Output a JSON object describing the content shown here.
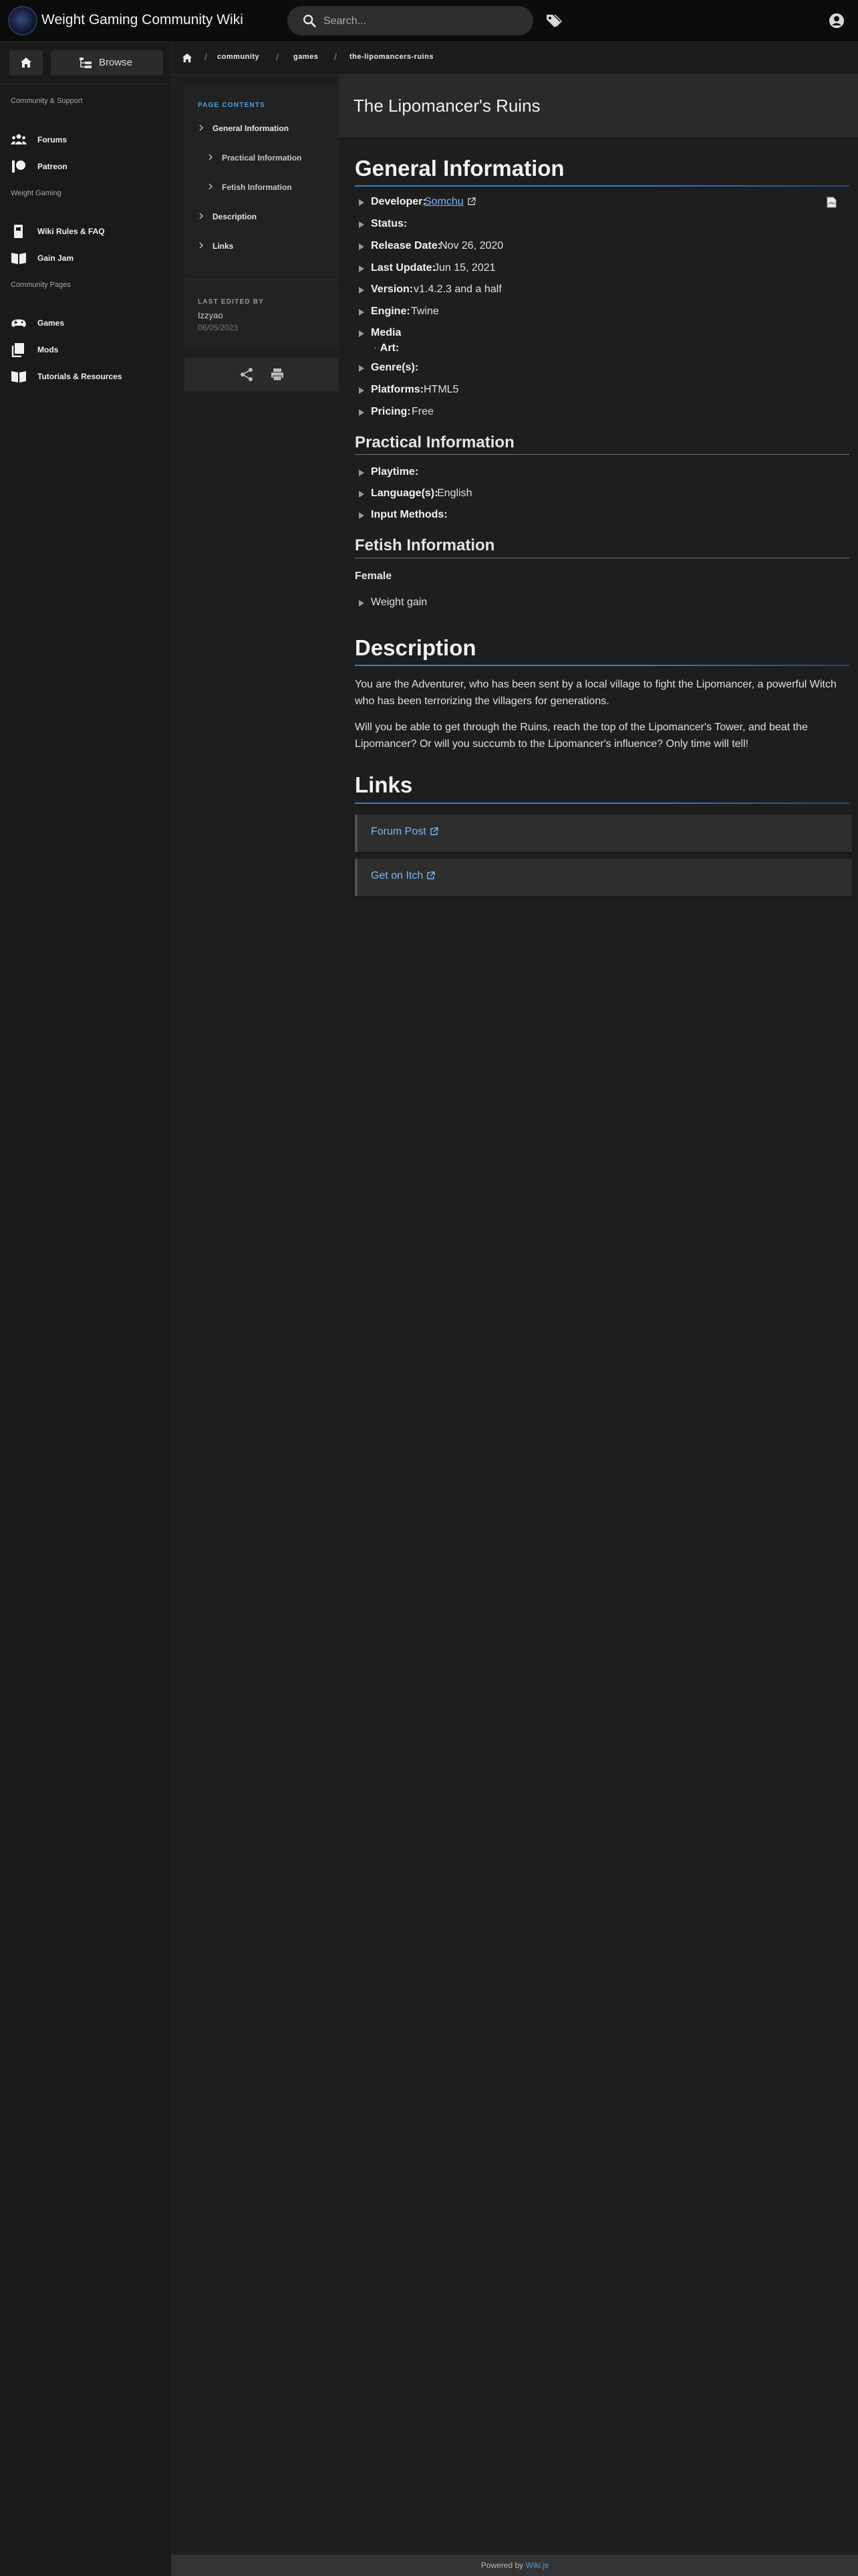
{
  "header": {
    "site_title": "Weight Gaming Community Wiki",
    "search_placeholder": "Search..."
  },
  "sidebar": {
    "browse_label": "Browse",
    "sections": [
      "Community & Support",
      "Weight Gaming",
      "Community Pages"
    ],
    "items": [
      {
        "label": "Forums",
        "icon": "users-icon"
      },
      {
        "label": "Patreon",
        "icon": "patreon-icon"
      },
      {
        "label": "Wiki Rules & FAQ",
        "icon": "book-icon"
      },
      {
        "label": "Gain Jam",
        "icon": "book-open-icon"
      },
      {
        "label": "Games",
        "icon": "gamepad-icon"
      },
      {
        "label": "Mods",
        "icon": "layers-icon"
      },
      {
        "label": "Tutorials & Resources",
        "icon": "book-open-icon"
      }
    ]
  },
  "breadcrumb": {
    "items": [
      "community",
      "games",
      "the-lipomancers-ruins"
    ]
  },
  "toc": {
    "heading": "PAGE CONTENTS",
    "items": [
      {
        "label": "General Information",
        "level": 1
      },
      {
        "label": "Practical Information",
        "level": 2
      },
      {
        "label": "Fetish Information",
        "level": 2
      },
      {
        "label": "Description",
        "level": 1
      },
      {
        "label": "Links",
        "level": 1
      }
    ],
    "last_edited_label": "LAST EDITED BY",
    "last_edited_user": "Izzyao",
    "last_edited_date": "06/05/2023"
  },
  "page": {
    "title": "The Lipomancer's Ruins"
  },
  "general": {
    "heading": "General Information",
    "rows": [
      {
        "key": "Developer:",
        "value": "Somchu",
        "link": true
      },
      {
        "key": "Status:",
        "value": ""
      },
      {
        "key": "Release Date:",
        "value": "Nov 26, 2020"
      },
      {
        "key": "Last Update:",
        "value": "Jun 15, 2021"
      },
      {
        "key": "Version:",
        "value": "v1.4.2.3 and a half"
      },
      {
        "key": "Engine:",
        "value": "Twine"
      },
      {
        "key": "Media",
        "value": ""
      },
      {
        "key": "Genre(s):",
        "value": ""
      },
      {
        "key": "Platforms:",
        "value": "HTML5"
      },
      {
        "key": "Pricing:",
        "value": "Free"
      }
    ],
    "media_sub": "Art:"
  },
  "practical": {
    "heading": "Practical Information",
    "rows": [
      {
        "key": "Playtime:",
        "value": ""
      },
      {
        "key": "Language(s):",
        "value": "English"
      },
      {
        "key": "Input Methods:",
        "value": ""
      }
    ]
  },
  "fetish": {
    "heading": "Fetish Information",
    "group": "Female",
    "items": [
      "Weight gain"
    ]
  },
  "description": {
    "heading": "Description",
    "paragraphs": [
      "You are the Adventurer, who has been sent by a local village to fight the Lipomancer, a powerful Witch who has been terrorizing the villagers for generations.",
      "Will you be able to get through the Ruins, reach the top of the Lipomancer's Tower, and beat the Lipomancer? Or will you succumb to the Lipomancer's influence? Only time will tell!"
    ]
  },
  "links": {
    "heading": "Links",
    "items": [
      "Forum Post",
      "Get on Itch"
    ]
  },
  "footer": {
    "prefix": "Powered by",
    "link": "Wiki.js"
  }
}
